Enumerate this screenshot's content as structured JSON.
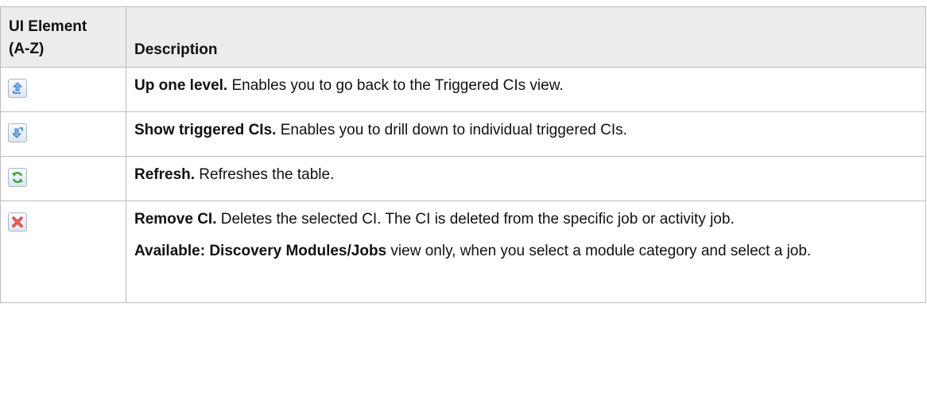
{
  "header": {
    "col1_line1": "UI Element",
    "col1_line2": "(A-Z)",
    "col2": "Description"
  },
  "rows": [
    {
      "icon": "up-one-level-icon",
      "title": "Up one level.",
      "text": " Enables you to go back to the Triggered CIs view."
    },
    {
      "icon": "show-triggered-cis-icon",
      "title": "Show triggered CIs.",
      "text": " Enables you to drill down to individual triggered CIs."
    },
    {
      "icon": "refresh-icon",
      "title": "Refresh.",
      "text": " Refreshes the table."
    },
    {
      "icon": "remove-ci-icon",
      "title": "Remove CI.",
      "text": " Deletes the selected CI. The CI is deleted from the specific job or activity job.",
      "note_title": "Available: Discovery Modules/Jobs",
      "note_text": " view only, when you select a module category and select a job."
    }
  ],
  "colors": {
    "header_bg": "#ececec",
    "border": "#bcbcbc",
    "arrow_blue": "#3a7bc8",
    "refresh_green": "#3aa335",
    "remove_red": "#d8322a"
  }
}
